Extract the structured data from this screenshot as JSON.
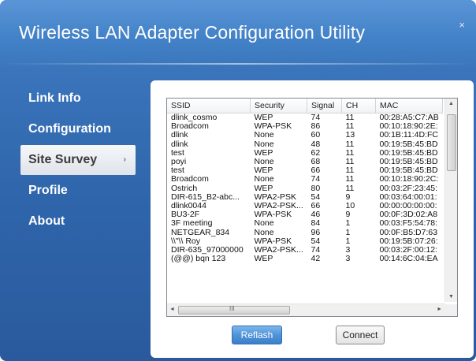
{
  "window": {
    "title": "Wireless LAN Adapter Configuration Utility",
    "close_glyph": "×"
  },
  "nav": {
    "items": [
      {
        "label": "Link Info"
      },
      {
        "label": "Configuration"
      },
      {
        "label": "Site Survey",
        "active": true,
        "chevron": "›"
      },
      {
        "label": "Profile"
      },
      {
        "label": "About"
      }
    ]
  },
  "site_survey": {
    "columns": [
      "SSID",
      "Security",
      "Signal",
      "CH",
      "MAC"
    ],
    "rows": [
      [
        "dlink_cosmo",
        "WEP",
        "74",
        "11",
        "00:28:A5:C7:AB"
      ],
      [
        "Broadcom",
        "WPA-PSK",
        "86",
        "11",
        "00:10:18:90:2E:"
      ],
      [
        "dlink",
        "None",
        "60",
        "13",
        "00:1B:11:4D:FC"
      ],
      [
        "dlink",
        "None",
        "48",
        "11",
        "00:19:5B:45:BD"
      ],
      [
        "test",
        "WEP",
        "62",
        "11",
        "00:19:5B:45:BD"
      ],
      [
        "poyi",
        "None",
        "68",
        "11",
        "00:19:5B:45:BD"
      ],
      [
        "test",
        "WEP",
        "66",
        "11",
        "00:19:5B:45:BD"
      ],
      [
        "Broadcom",
        "None",
        "74",
        "11",
        "00:10:18:90:2C:"
      ],
      [
        "Ostrich",
        "WEP",
        "80",
        "11",
        "00:03:2F:23:45:"
      ],
      [
        "DIR-615_B2-abc...",
        "WPA2-PSK",
        "54",
        "9",
        "00:03:64:00:01:"
      ],
      [
        "dlink0044",
        "WPA2-PSK...",
        "66",
        "10",
        "00:00:00:00:00:"
      ],
      [
        "BU3-2F",
        "WPA-PSK",
        "46",
        "9",
        "00:0F:3D:02:A8"
      ],
      [
        "3F meeting",
        "None",
        "84",
        "1",
        "00:03:F5:54:78:"
      ],
      [
        "NETGEAR_834",
        "None",
        "96",
        "1",
        "00:0F:B5:D7:63"
      ],
      [
        "\\\\\"\\\\   Roy",
        "WPA-PSK",
        "54",
        "1",
        "00:19:5B:07:26:"
      ],
      [
        "DIR-635_97000000",
        "WPA2-PSK...",
        "74",
        "3",
        "00:03:2F:00:12:"
      ],
      [
        "(@@) bqn 123",
        "WEP",
        "42",
        "3",
        "00:14:6C:04:EA"
      ]
    ],
    "scroll_up": "▲",
    "scroll_down": "▼",
    "scroll_left": "◄",
    "scroll_right": "►",
    "hgrip": "III"
  },
  "buttons": {
    "reflash": "Reflash",
    "connect": "Connect"
  }
}
